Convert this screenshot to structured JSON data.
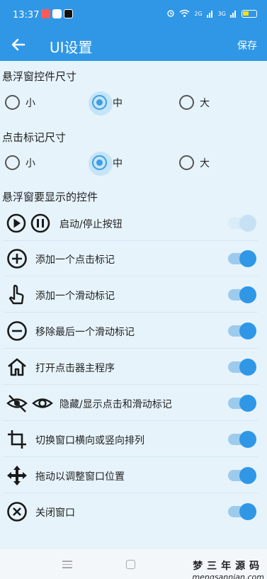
{
  "status_bar": {
    "time": "13:37",
    "network": "2G",
    "network2": "3G"
  },
  "app_bar": {
    "title": "UI设置",
    "save_label": "保存"
  },
  "sections": {
    "floating_size": {
      "title": "悬浮窗控件尺寸",
      "options": [
        "小",
        "中",
        "大"
      ],
      "selected": "中"
    },
    "marker_size": {
      "title": "点击标记尺寸",
      "options": [
        "小",
        "中",
        "大"
      ],
      "selected": "中"
    },
    "controls": {
      "title": "悬浮窗要显示的控件",
      "items": [
        {
          "label": "启动/停止按钮",
          "icon": "play-pause-icon",
          "enabled": true
        },
        {
          "label": "添加一个点击标记",
          "icon": "add-circle-icon",
          "enabled": true
        },
        {
          "label": "添加一个滑动标记",
          "icon": "swipe-hand-icon",
          "enabled": true
        },
        {
          "label": "移除最后一个滑动标记",
          "icon": "remove-circle-icon",
          "enabled": true
        },
        {
          "label": "打开点击器主程序",
          "icon": "home-icon",
          "enabled": true
        },
        {
          "label": "隐藏/显示点击和滑动标记",
          "icon": "visibility-icon",
          "enabled": true
        },
        {
          "label": "切换窗口横向或竖向排列",
          "icon": "crop-rotate-icon",
          "enabled": true
        },
        {
          "label": "拖动以调整窗口位置",
          "icon": "move-arrows-icon",
          "enabled": true
        },
        {
          "label": "关闭窗口",
          "icon": "close-circle-icon",
          "enabled": true
        }
      ]
    }
  },
  "watermark": {
    "cn": "梦三年源码",
    "en": "mengsannian.com"
  },
  "colors": {
    "primary": "#2f97e6",
    "background": "#e6f3fb",
    "toggle_on": "#2f97e6"
  }
}
